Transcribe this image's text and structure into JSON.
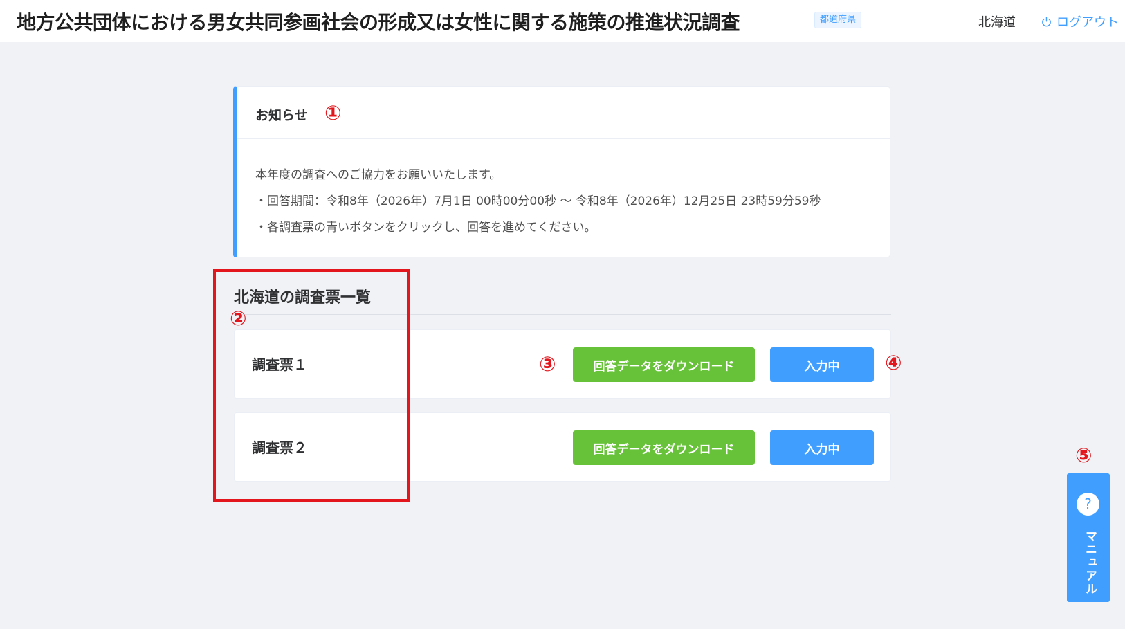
{
  "header": {
    "title": "地方公共団体における男女共同参画社会の形成又は女性に関する施策の推進状況調査",
    "role_badge": "都道府県",
    "user_name": "北海道",
    "logout_label": "ログアウト",
    "logout_icon": "power-icon"
  },
  "notice": {
    "title": "お知らせ",
    "lines": [
      "本年度の調査へのご協力をお願いいたします。",
      "・回答期間：令和8年（2026年）7月1日 00時00分00秒 ～ 令和8年（2026年）12月25日 23時59分59秒",
      "・各調査票の青いボタンをクリックし、回答を進めてください。"
    ]
  },
  "survey_list": {
    "title": "北海道の調査票一覧",
    "items": [
      {
        "name": "調査票１",
        "download_label": "回答データをダウンロード",
        "status_label": "入力中"
      },
      {
        "name": "調査票２",
        "download_label": "回答データをダウンロード",
        "status_label": "入力中"
      }
    ]
  },
  "manual_tab": {
    "icon": "question-icon",
    "icon_glyph": "?",
    "label": "マニュアル"
  },
  "callouts": [
    "①",
    "②",
    "③",
    "④",
    "⑤"
  ],
  "colors": {
    "accent": "#409eff",
    "download_button": "#67c23a",
    "callout": "#e2161c"
  }
}
